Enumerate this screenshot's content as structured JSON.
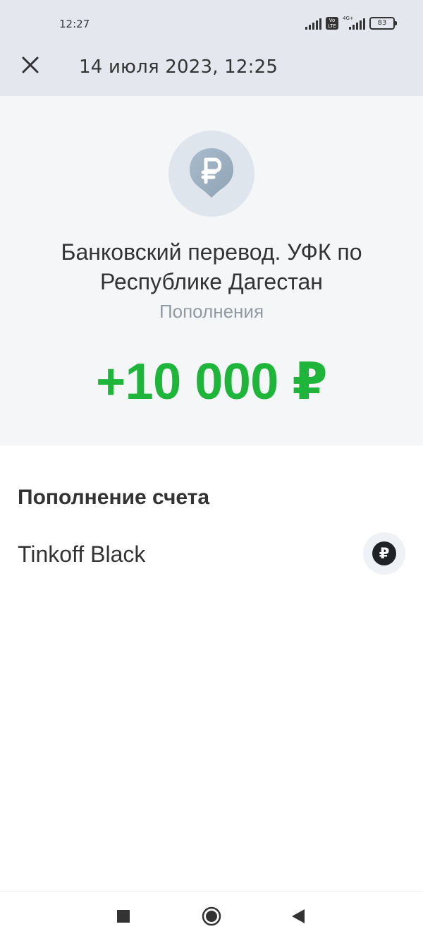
{
  "status_bar": {
    "time": "12:27",
    "volte_label": "Vo LTE",
    "network_label": "4G+",
    "battery": "83"
  },
  "header": {
    "close_icon": "close-icon",
    "title": "14 июля 2023, 12:25"
  },
  "transaction": {
    "logo_icon": "ruble-icon",
    "merchant": "Банковский перевод. УФК по Республике Дагестан",
    "category": "Пополнения",
    "amount": "+10 000 ₽",
    "amount_color": "#1fb53b"
  },
  "account_section": {
    "title": "Пополнение счета",
    "account_name": "Tinkoff Black",
    "account_icon": "ruble-icon",
    "account_icon_glyph": "₽"
  },
  "nav_bar": {
    "recents_icon": "square-icon",
    "home_icon": "circle-icon",
    "back_icon": "triangle-back-icon"
  },
  "colors": {
    "header_bg": "#e4e8ee",
    "hero_bg": "#f5f6f8",
    "amount_green": "#1fb53b",
    "category_gray": "#9199a3"
  }
}
